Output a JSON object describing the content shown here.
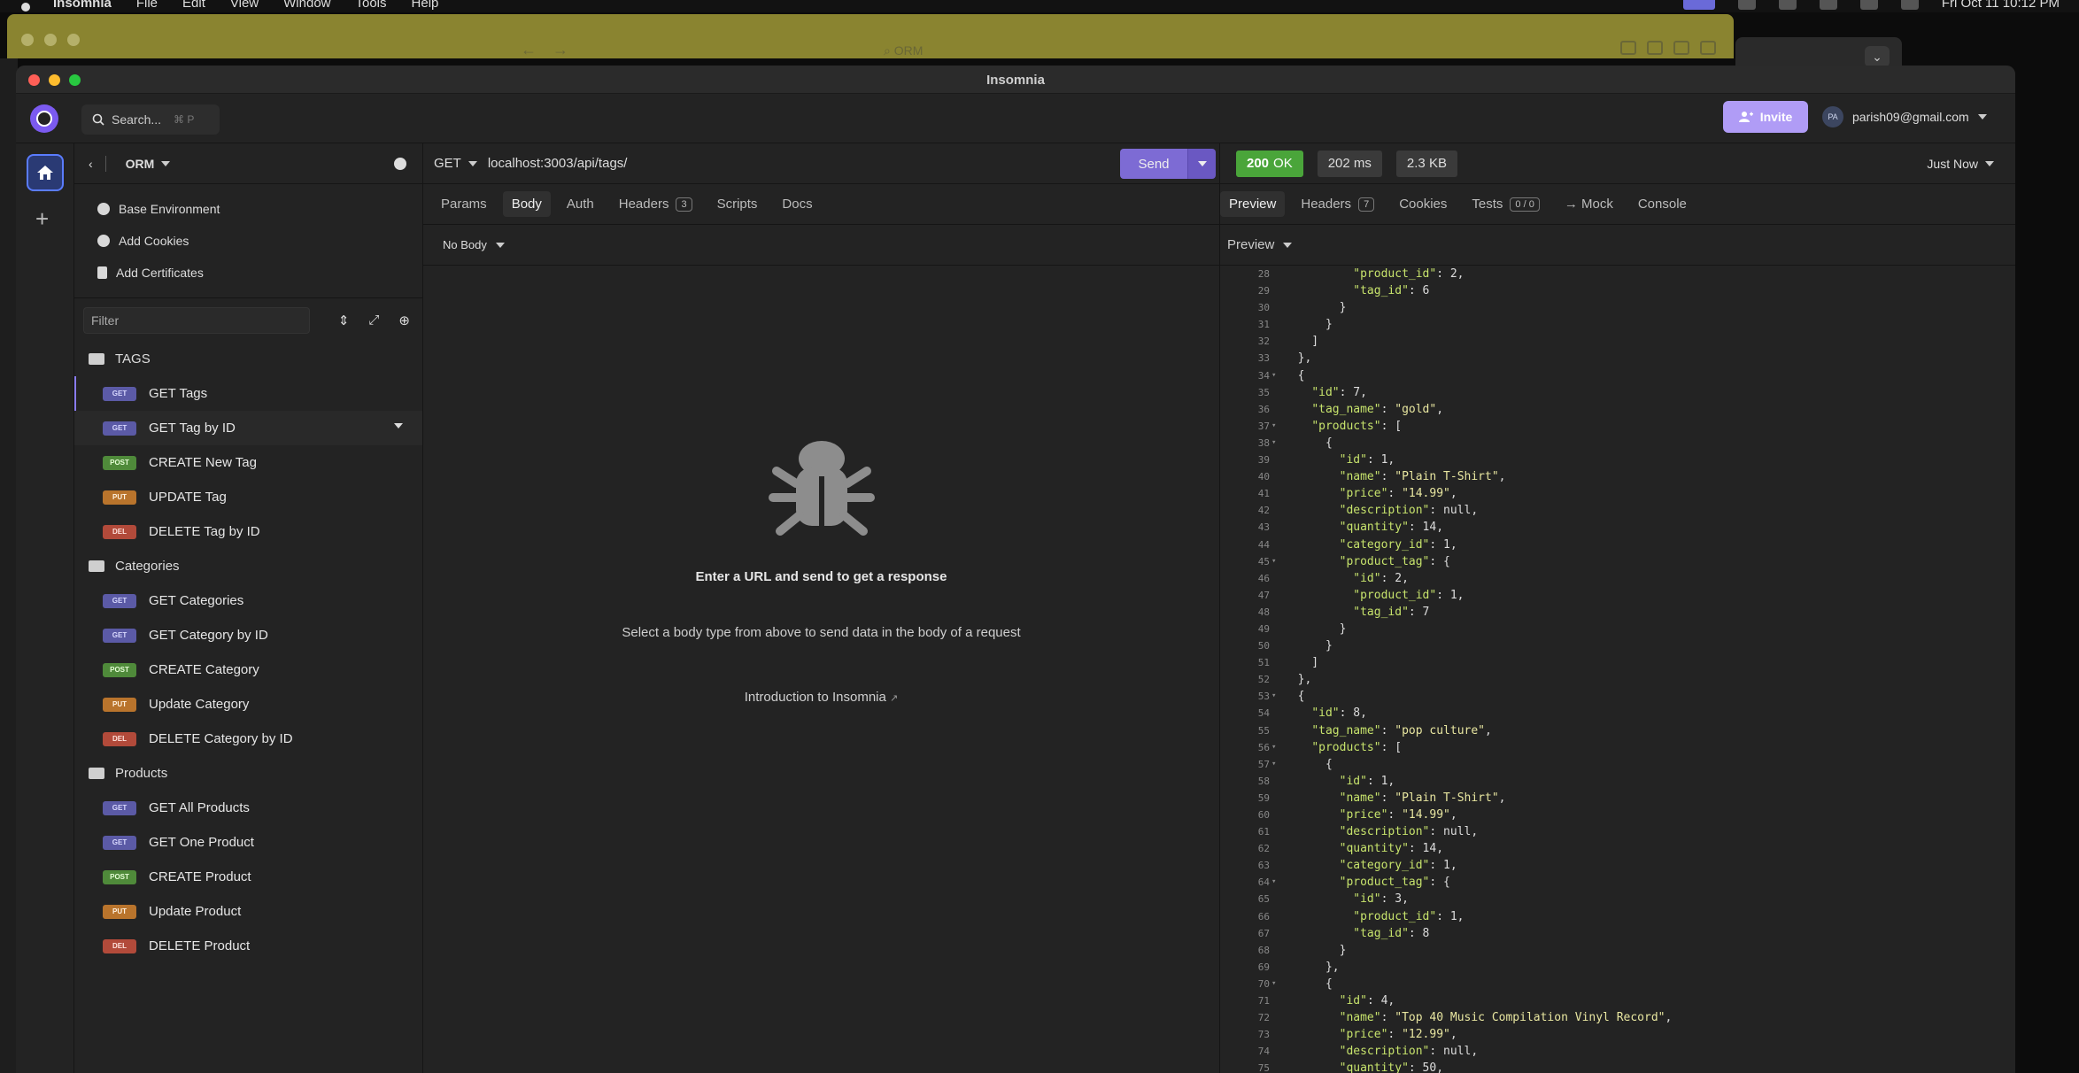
{
  "menubar": {
    "app": "Insomnia",
    "items": [
      "File",
      "Edit",
      "View",
      "Window",
      "Tools",
      "Help"
    ],
    "clock": "Fri Oct 11  10:12 PM"
  },
  "background_window": {
    "url": "ORM"
  },
  "window": {
    "title": "Insomnia"
  },
  "topbar": {
    "search_label": "Search...",
    "search_shortcut": "⌘ P",
    "invite_label": "Invite",
    "account_initials": "PA",
    "account_email": "parish09@gmail.com"
  },
  "sidebar": {
    "project": "ORM",
    "env_items": [
      {
        "label": "Base Environment",
        "icon": "globe-icon"
      },
      {
        "label": "Add Cookies",
        "icon": "cookie-icon"
      },
      {
        "label": "Add Certificates",
        "icon": "certificate-icon"
      }
    ],
    "filter_placeholder": "Filter",
    "folders": [
      {
        "name": "TAGS",
        "requests": [
          {
            "method": "GET",
            "label": "GET Tags"
          },
          {
            "method": "GET",
            "label": "GET Tag by ID"
          },
          {
            "method": "POST",
            "label": "CREATE New Tag"
          },
          {
            "method": "PUT",
            "label": "UPDATE Tag"
          },
          {
            "method": "DEL",
            "label": "DELETE Tag by ID"
          }
        ]
      },
      {
        "name": "Categories",
        "requests": [
          {
            "method": "GET",
            "label": "GET Categories"
          },
          {
            "method": "GET",
            "label": "GET Category by ID"
          },
          {
            "method": "POST",
            "label": "CREATE Category"
          },
          {
            "method": "PUT",
            "label": "Update Category"
          },
          {
            "method": "DEL",
            "label": "DELETE Category by ID"
          }
        ]
      },
      {
        "name": "Products",
        "requests": [
          {
            "method": "GET",
            "label": "GET All Products"
          },
          {
            "method": "GET",
            "label": "GET One Product"
          },
          {
            "method": "POST",
            "label": "CREATE Product"
          },
          {
            "method": "PUT",
            "label": "Update Product"
          },
          {
            "method": "DEL",
            "label": "DELETE Product"
          }
        ]
      }
    ]
  },
  "request": {
    "method": "GET",
    "url": "localhost:3003/api/tags/",
    "send_label": "Send",
    "tabs": [
      {
        "label": "Params"
      },
      {
        "label": "Body",
        "active": true
      },
      {
        "label": "Auth"
      },
      {
        "label": "Headers",
        "count": "3"
      },
      {
        "label": "Scripts"
      },
      {
        "label": "Docs"
      }
    ],
    "body_type": "No Body",
    "empty_title": "Enter a URL and send to get a response",
    "empty_hint": "Select a body type from above to send data in the body of a request",
    "empty_link": "Introduction to Insomnia"
  },
  "response": {
    "status_code": "200",
    "status_text": "OK",
    "time": "202 ms",
    "size": "2.3 KB",
    "timestamp": "Just Now",
    "tabs": [
      {
        "label": "Preview",
        "active": true
      },
      {
        "label": "Headers",
        "count": "7"
      },
      {
        "label": "Cookies"
      },
      {
        "label": "Tests",
        "count": "0 / 0"
      },
      {
        "label": "→ Mock"
      },
      {
        "label": "Console"
      }
    ],
    "preview_mode": "Preview",
    "lines": [
      {
        "n": "28",
        "t": "          \"product_id\": 2,"
      },
      {
        "n": "29",
        "t": "          \"tag_id\": 6"
      },
      {
        "n": "30",
        "t": "        }"
      },
      {
        "n": "31",
        "t": "      }"
      },
      {
        "n": "32",
        "t": "    ]"
      },
      {
        "n": "33",
        "t": "  },"
      },
      {
        "n": "34",
        "t": "  {",
        "fold": true
      },
      {
        "n": "35",
        "t": "    \"id\": 7,"
      },
      {
        "n": "36",
        "t": "    \"tag_name\": \"gold\","
      },
      {
        "n": "37",
        "t": "    \"products\": [",
        "fold": true
      },
      {
        "n": "38",
        "t": "      {",
        "fold": true
      },
      {
        "n": "39",
        "t": "        \"id\": 1,"
      },
      {
        "n": "40",
        "t": "        \"name\": \"Plain T-Shirt\","
      },
      {
        "n": "41",
        "t": "        \"price\": \"14.99\","
      },
      {
        "n": "42",
        "t": "        \"description\": null,"
      },
      {
        "n": "43",
        "t": "        \"quantity\": 14,"
      },
      {
        "n": "44",
        "t": "        \"category_id\": 1,"
      },
      {
        "n": "45",
        "t": "        \"product_tag\": {",
        "fold": true
      },
      {
        "n": "46",
        "t": "          \"id\": 2,"
      },
      {
        "n": "47",
        "t": "          \"product_id\": 1,"
      },
      {
        "n": "48",
        "t": "          \"tag_id\": 7"
      },
      {
        "n": "49",
        "t": "        }"
      },
      {
        "n": "50",
        "t": "      }"
      },
      {
        "n": "51",
        "t": "    ]"
      },
      {
        "n": "52",
        "t": "  },"
      },
      {
        "n": "53",
        "t": "  {",
        "fold": true
      },
      {
        "n": "54",
        "t": "    \"id\": 8,"
      },
      {
        "n": "55",
        "t": "    \"tag_name\": \"pop culture\","
      },
      {
        "n": "56",
        "t": "    \"products\": [",
        "fold": true
      },
      {
        "n": "57",
        "t": "      {",
        "fold": true
      },
      {
        "n": "58",
        "t": "        \"id\": 1,"
      },
      {
        "n": "59",
        "t": "        \"name\": \"Plain T-Shirt\","
      },
      {
        "n": "60",
        "t": "        \"price\": \"14.99\","
      },
      {
        "n": "61",
        "t": "        \"description\": null,"
      },
      {
        "n": "62",
        "t": "        \"quantity\": 14,"
      },
      {
        "n": "63",
        "t": "        \"category_id\": 1,"
      },
      {
        "n": "64",
        "t": "        \"product_tag\": {",
        "fold": true
      },
      {
        "n": "65",
        "t": "          \"id\": 3,"
      },
      {
        "n": "66",
        "t": "          \"product_id\": 1,"
      },
      {
        "n": "67",
        "t": "          \"tag_id\": 8"
      },
      {
        "n": "68",
        "t": "        }"
      },
      {
        "n": "69",
        "t": "      },"
      },
      {
        "n": "70",
        "t": "      {",
        "fold": true
      },
      {
        "n": "71",
        "t": "        \"id\": 4,"
      },
      {
        "n": "72",
        "t": "        \"name\": \"Top 40 Music Compilation Vinyl Record\","
      },
      {
        "n": "73",
        "t": "        \"price\": \"12.99\","
      },
      {
        "n": "74",
        "t": "        \"description\": null,"
      },
      {
        "n": "75",
        "t": "        \"quantity\": 50,"
      }
    ]
  },
  "colors": {
    "accent": "#7d6bd4",
    "status_ok": "#4aa53a",
    "get": "#5b5aa6",
    "post": "#4f8a3a",
    "put": "#b9742c",
    "del": "#b24a3a"
  }
}
